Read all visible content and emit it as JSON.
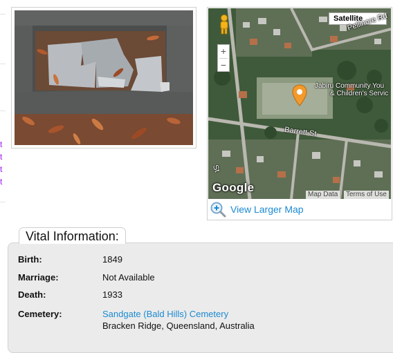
{
  "left_edge": {
    "links": [
      "t",
      "t",
      "t",
      "t"
    ]
  },
  "photo": {
    "alt": "Headstone photo"
  },
  "map": {
    "type_label": "Satellite",
    "zoom_in": "+",
    "zoom_out": "−",
    "place_label_1": "Jabiru Community You",
    "place_label_2": "& Children's Servic",
    "street_1": "Pellinore Rd",
    "street_2": "Barrett St",
    "street_3": "St",
    "logo": "Google",
    "map_data": "Map Data",
    "terms": "Terms of Use",
    "view_larger": "View Larger Map",
    "colors": {
      "link": "#1b8ad1",
      "pin": "#f39a2b"
    }
  },
  "vital": {
    "heading": "Vital Information:",
    "rows": [
      {
        "label": "Birth:",
        "value": "1849"
      },
      {
        "label": "Marriage:",
        "value": "Not Available"
      },
      {
        "label": "Death:",
        "value": "1933"
      },
      {
        "label": "Cemetery:",
        "value": "Sandgate (Bald Hills) Cemetery",
        "value2": "Bracken Ridge, Queensland, Australia"
      }
    ]
  }
}
